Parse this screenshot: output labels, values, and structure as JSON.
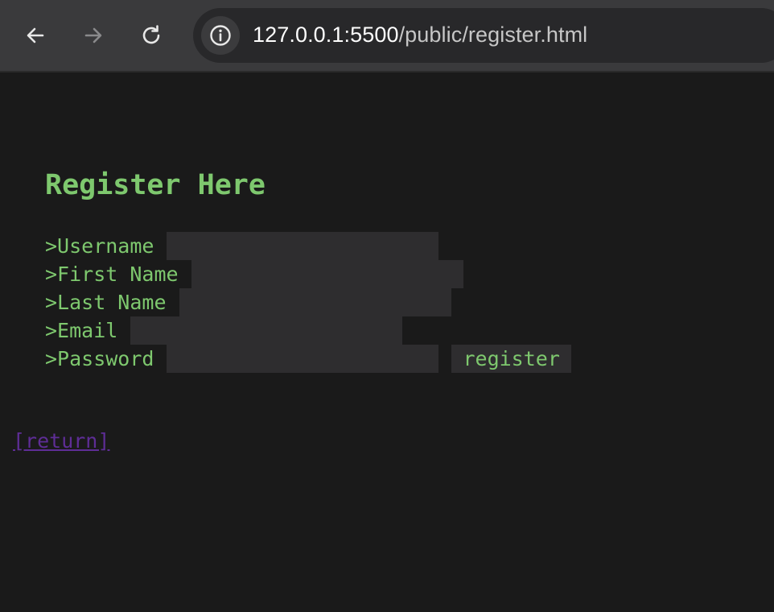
{
  "browser": {
    "url_host": "127.0.0.1:5500",
    "url_path": "/public/register.html",
    "icons": {
      "back": "arrow-left-icon",
      "forward": "arrow-right-icon",
      "reload": "reload-icon",
      "info": "info-icon"
    }
  },
  "page": {
    "title": "Register Here",
    "fields": [
      {
        "label": ">Username",
        "value": ""
      },
      {
        "label": ">First Name",
        "value": ""
      },
      {
        "label": ">Last Name",
        "value": ""
      },
      {
        "label": ">Email",
        "value": ""
      },
      {
        "label": ">Password",
        "value": ""
      }
    ],
    "register_label": "register",
    "return_label": "[return]"
  },
  "colors": {
    "background": "#1a1a1a",
    "accent_green": "#7ec86e",
    "input_bg": "#2e2d2f",
    "link_purple": "#5e2d96"
  }
}
